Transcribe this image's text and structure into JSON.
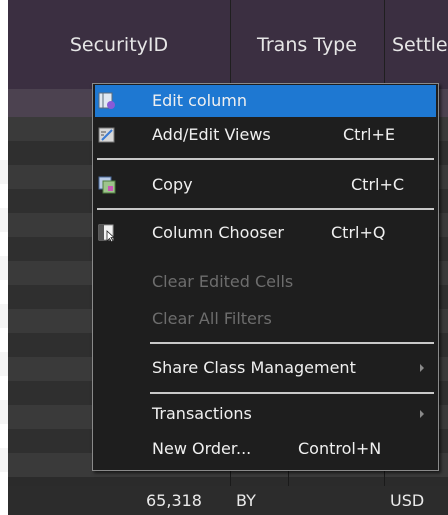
{
  "grid": {
    "columns": [
      {
        "label": "SecurityID"
      },
      {
        "label": "Trans Type"
      },
      {
        "label": "Settle"
      }
    ],
    "bottom_row": {
      "amount": "65,318",
      "trans_type": "BY",
      "currency": "USD"
    }
  },
  "context_menu": {
    "items": [
      {
        "label": "Edit column",
        "shortcut": "",
        "icon": "edit-column-icon",
        "state": "highlighted"
      },
      {
        "label": "Add/Edit Views",
        "shortcut": "Ctrl+E",
        "icon": "edit-views-icon",
        "state": "enabled"
      },
      {
        "label": "Copy",
        "shortcut": "Ctrl+C",
        "icon": "copy-icon",
        "state": "enabled"
      },
      {
        "label": "Column Chooser",
        "shortcut": "Ctrl+Q",
        "icon": "column-chooser-icon",
        "state": "enabled"
      },
      {
        "label": "Clear Edited Cells",
        "shortcut": "",
        "state": "disabled"
      },
      {
        "label": "Clear All Filters",
        "shortcut": "",
        "state": "disabled"
      },
      {
        "label": "Share Class Management",
        "shortcut": "",
        "state": "submenu"
      },
      {
        "label": "Transactions",
        "shortcut": "",
        "state": "submenu"
      },
      {
        "label": "New Order...",
        "shortcut": "Control+N",
        "state": "enabled"
      }
    ]
  },
  "colors": {
    "menu_highlight": "#1e78d2",
    "header_bg": "#3b2f41",
    "grid_bg": "#2b2b2b"
  }
}
